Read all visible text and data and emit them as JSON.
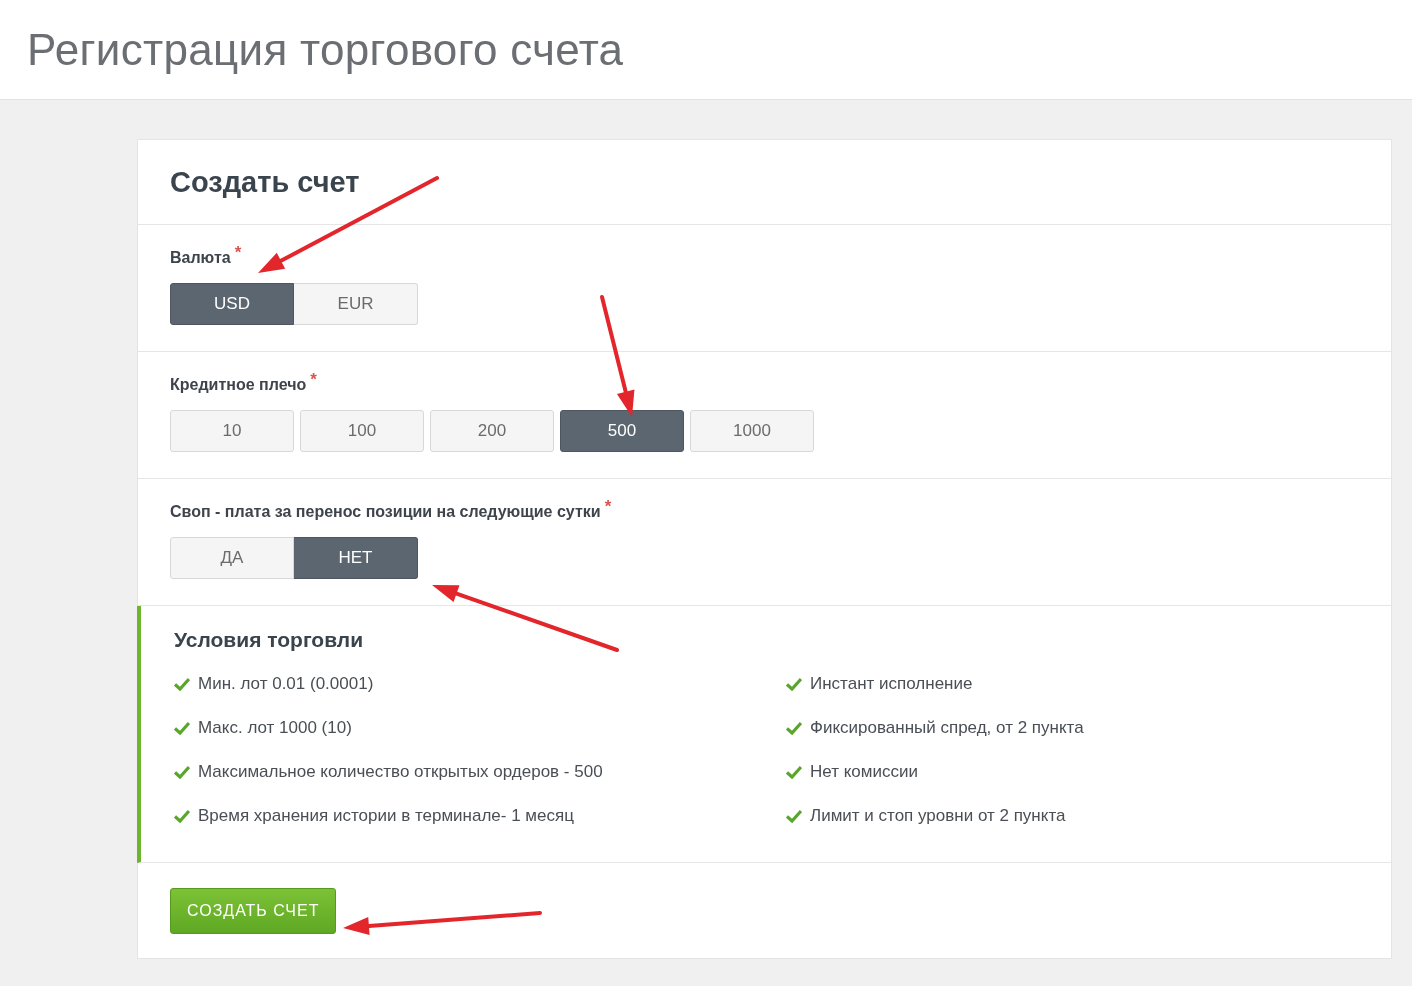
{
  "page_title": "Регистрация торгового счета",
  "card": {
    "heading": "Создать счет",
    "fields": [
      {
        "label": "Валюта",
        "required_mark": "*",
        "kind": "joined",
        "options": [
          {
            "label": "USD",
            "selected": true
          },
          {
            "label": "EUR",
            "selected": false
          }
        ]
      },
      {
        "label": "Кредитное плечо",
        "required_mark": "*",
        "kind": "spaced",
        "options": [
          {
            "label": "10",
            "selected": false
          },
          {
            "label": "100",
            "selected": false
          },
          {
            "label": "200",
            "selected": false
          },
          {
            "label": "500",
            "selected": true
          },
          {
            "label": "1000",
            "selected": false
          }
        ]
      },
      {
        "label": "Своп - плата за перенос позиции на следующие сутки",
        "required_mark": "*",
        "kind": "joined",
        "options": [
          {
            "label": "ДА",
            "selected": false
          },
          {
            "label": "НЕТ",
            "selected": true
          }
        ]
      }
    ],
    "conditions": {
      "title": "Условия торговли",
      "left": [
        "Мин. лот 0.01 (0.0001)",
        "Макс. лот 1000 (10)",
        "Максимальное количество открытых ордеров - 500",
        "Время хранения истории в терминале- 1 месяц"
      ],
      "right": [
        "Инстант исполнение",
        "Фиксированный спред, от 2 пункта",
        "Нет комиссии",
        "Лимит и стоп уровни от 2 пункта"
      ]
    },
    "submit_button": "СОЗДАТЬ СЧЕТ"
  }
}
